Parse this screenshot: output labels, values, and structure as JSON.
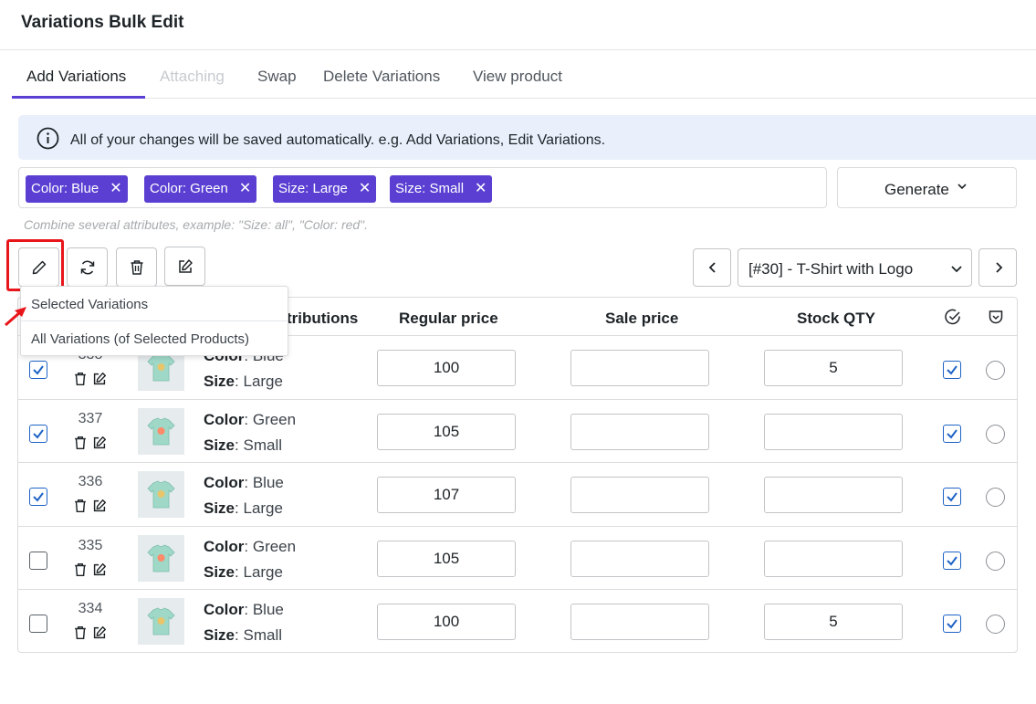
{
  "header": {
    "title": "Variations Bulk Edit"
  },
  "tabs": [
    {
      "label": "Add Variations",
      "state": "active"
    },
    {
      "label": "Attaching",
      "state": "disabled"
    },
    {
      "label": "Swap",
      "state": "normal"
    },
    {
      "label": "Delete Variations",
      "state": "normal"
    },
    {
      "label": "View product",
      "state": "normal"
    }
  ],
  "notice": {
    "icon": "info-icon",
    "text": "All of your changes will be saved automatically. e.g. Add Variations, Edit Variations."
  },
  "attributes": {
    "chips": [
      "Color: Blue",
      "Color: Green",
      "Size: Large",
      "Size: Small"
    ],
    "chip_remove_icon": "close-icon",
    "hint": "Combine several attributes, example: \"Size: all\", \"Color: red\".",
    "chip_color": "#5b3fd2"
  },
  "generate": {
    "label": "Generate",
    "icon": "chevron-down-icon"
  },
  "toolbar": {
    "buttons": [
      "pencil-icon",
      "refresh-icon",
      "trash-icon",
      "edit-square-icon"
    ],
    "prev_icon": "chevron-left-icon",
    "next_icon": "chevron-right-icon",
    "product_selected": "[#30] - T-Shirt with Logo"
  },
  "dropdown": {
    "items": [
      "Selected Variations",
      "All Variations (of Selected Products)"
    ]
  },
  "table": {
    "headers": {
      "attributes": "Attributions",
      "regular_price": "Regular price",
      "sale_price": "Sale price",
      "stock_qty": "Stock QTY"
    },
    "header_icons": [
      "check-circle-icon",
      "shield-check-icon"
    ],
    "rows": [
      {
        "checked": true,
        "id": "338",
        "color_label": "Color",
        "color": "Blue",
        "size_label": "Size",
        "size": "Large",
        "regular_price": "100",
        "sale_price": "",
        "stock_qty": "5",
        "enabled": true
      },
      {
        "checked": true,
        "id": "337",
        "color_label": "Color",
        "color": "Green",
        "size_label": "Size",
        "size": "Small",
        "regular_price": "105",
        "sale_price": "",
        "stock_qty": "",
        "enabled": true
      },
      {
        "checked": true,
        "id": "336",
        "color_label": "Color",
        "color": "Blue",
        "size_label": "Size",
        "size": "Large",
        "regular_price": "107",
        "sale_price": "",
        "stock_qty": "",
        "enabled": true
      },
      {
        "checked": false,
        "id": "335",
        "color_label": "Color",
        "color": "Green",
        "size_label": "Size",
        "size": "Large",
        "regular_price": "105",
        "sale_price": "",
        "stock_qty": "",
        "enabled": true
      },
      {
        "checked": false,
        "id": "334",
        "color_label": "Color",
        "color": "Blue",
        "size_label": "Size",
        "size": "Small",
        "regular_price": "100",
        "sale_price": "",
        "stock_qty": "5",
        "enabled": true
      }
    ]
  },
  "colors": {
    "accent": "#5b3fd2",
    "highlight": "#e8161b",
    "checkbox": "#1e63c6",
    "notice_bg": "#eaf0fb"
  }
}
